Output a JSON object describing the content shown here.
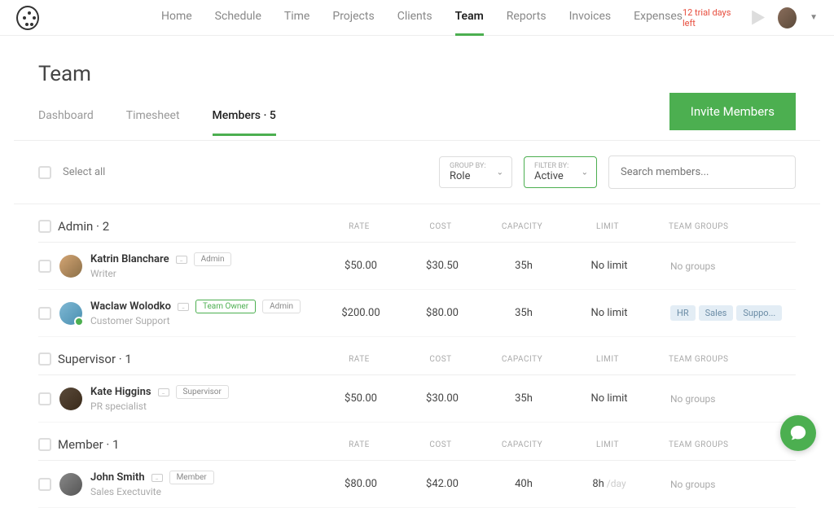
{
  "nav": {
    "items": [
      "Home",
      "Schedule",
      "Time",
      "Projects",
      "Clients",
      "Team",
      "Reports",
      "Invoices",
      "Expenses"
    ],
    "active": 5,
    "trial": "12 trial days left"
  },
  "page": {
    "title": "Team"
  },
  "subnav": {
    "items": [
      "Dashboard",
      "Timesheet",
      "Members · 5"
    ],
    "active": 2
  },
  "invite": "Invite Members",
  "toolbar": {
    "select_all": "Select all",
    "group_by_label": "GROUP BY:",
    "group_by_value": "Role",
    "filter_by_label": "FILTER BY:",
    "filter_by_value": "Active",
    "search_placeholder": "Search members..."
  },
  "columns": {
    "rate": "RATE",
    "cost": "COST",
    "capacity": "CAPACITY",
    "limit": "LIMIT",
    "groups": "TEAM GROUPS"
  },
  "groups": [
    {
      "name": "Admin · 2",
      "members": [
        {
          "name": "Katrin Blanchare",
          "role": "Writer",
          "badges": [
            {
              "text": "Admin",
              "owner": false
            }
          ],
          "rate": "$50.00",
          "cost": "$30.50",
          "capacity": "35h",
          "limit": "No limit",
          "limit_sub": "",
          "groups_text": "No groups",
          "tags": [],
          "avatar": "av1"
        },
        {
          "name": "Waclaw Wolodko",
          "role": "Customer Support",
          "badges": [
            {
              "text": "Team Owner",
              "owner": true
            },
            {
              "text": "Admin",
              "owner": false
            }
          ],
          "rate": "$200.00",
          "cost": "$80.00",
          "capacity": "35h",
          "limit": "No limit",
          "limit_sub": "",
          "groups_text": "",
          "tags": [
            "HR",
            "Sales",
            "Suppo..."
          ],
          "avatar": "av2"
        }
      ]
    },
    {
      "name": "Supervisor · 1",
      "members": [
        {
          "name": "Kate Higgins",
          "role": "PR specialist",
          "badges": [
            {
              "text": "Supervisor",
              "owner": false
            }
          ],
          "rate": "$50.00",
          "cost": "$30.00",
          "capacity": "35h",
          "limit": "No limit",
          "limit_sub": "",
          "groups_text": "No groups",
          "tags": [],
          "avatar": "av3"
        }
      ]
    },
    {
      "name": "Member · 1",
      "members": [
        {
          "name": "John Smith",
          "role": "Sales Exectuvite",
          "badges": [
            {
              "text": "Member",
              "owner": false
            }
          ],
          "rate": "$80.00",
          "cost": "$42.00",
          "capacity": "40h",
          "limit": "8h",
          "limit_sub": " /day",
          "groups_text": "No groups",
          "tags": [],
          "avatar": "av4"
        }
      ]
    }
  ]
}
